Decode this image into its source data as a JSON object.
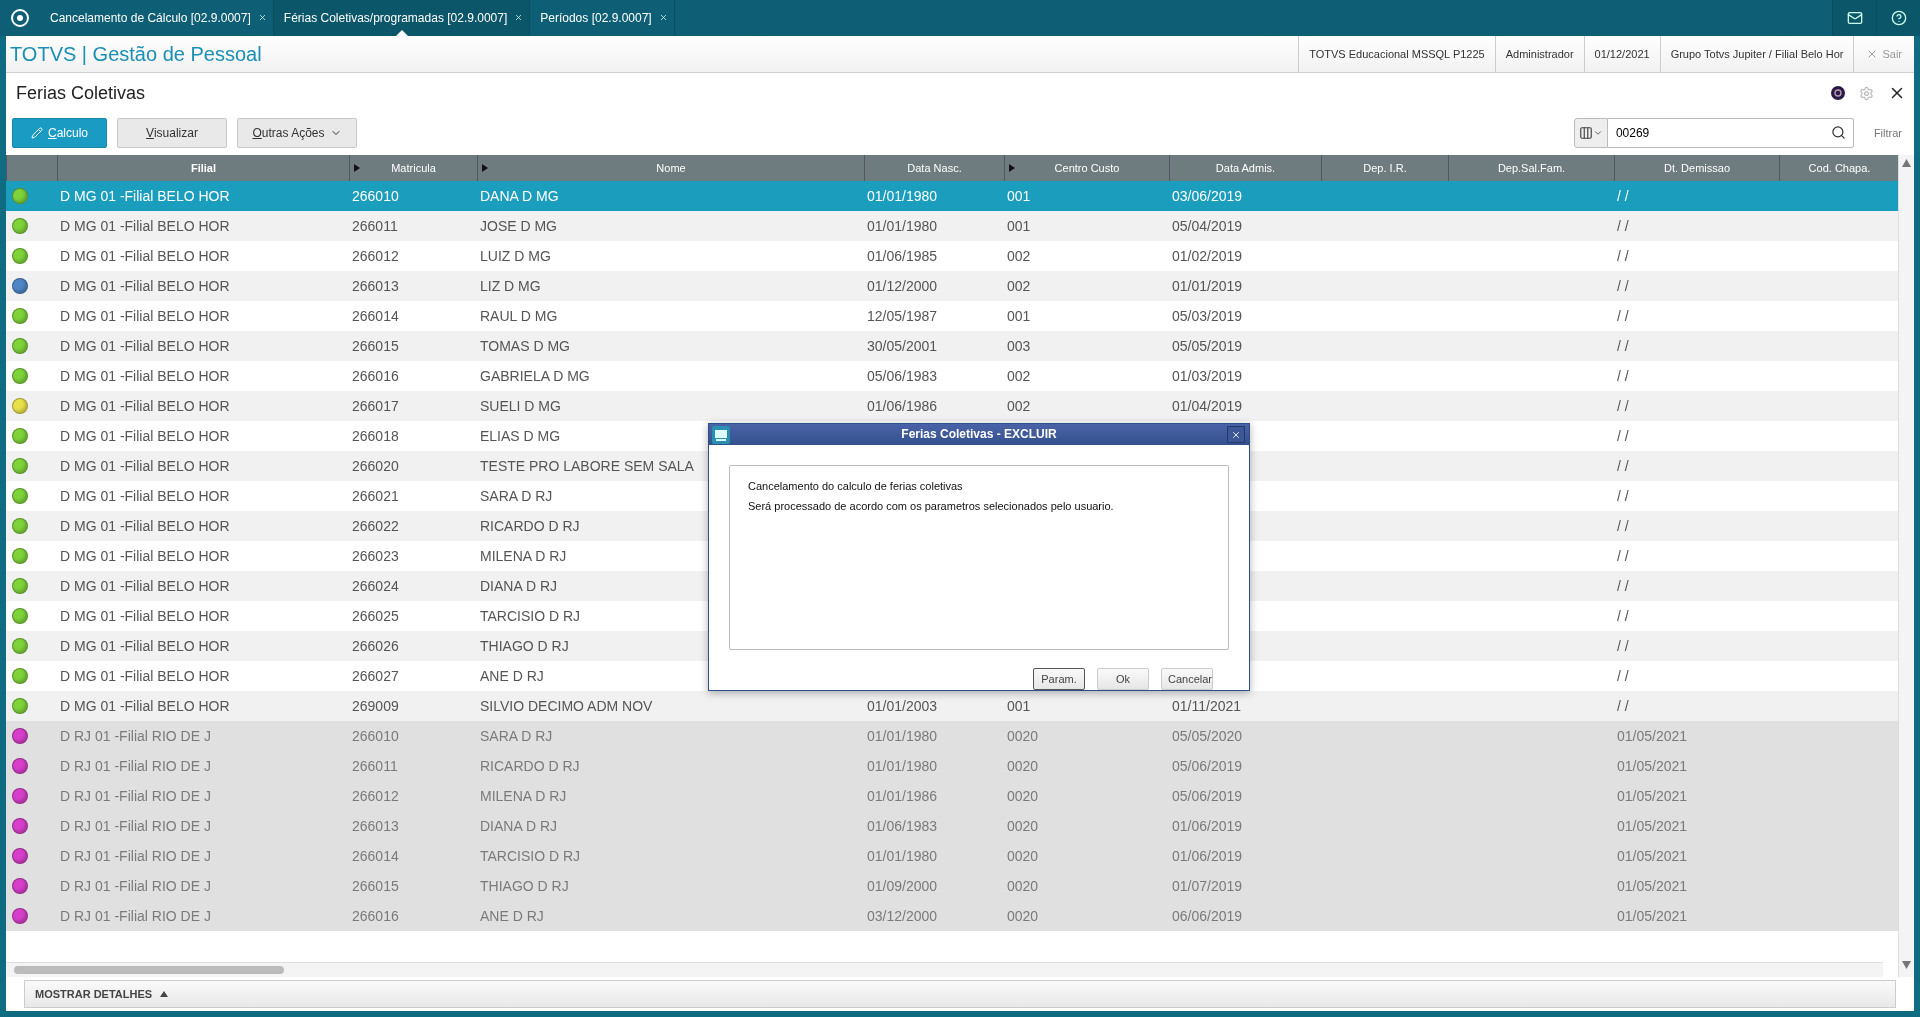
{
  "tabs": [
    {
      "label": "Cancelamento de Cálculo [02.9.0007]",
      "selected": false
    },
    {
      "label": "Férias Coletivas/programadas [02.9.0007]",
      "selected": true
    },
    {
      "label": "Períodos [02.9.0007]",
      "selected": false
    }
  ],
  "header": {
    "brand": "TOTVS | Gestão de Pessoal",
    "info": [
      "TOTVS Educacional MSSQL P1225",
      "Administrador",
      "01/12/2021",
      "Grupo Totvs Jupiter / Filial Belo Hor"
    ],
    "logout": "Sair"
  },
  "page_title": "Ferias Coletivas",
  "toolbar": {
    "buttons": [
      {
        "label": "Calculo",
        "kind": "primary"
      },
      {
        "label": "Visualizar",
        "kind": "default"
      },
      {
        "label": "Outras Ações",
        "kind": "dropdown"
      }
    ],
    "search": {
      "value": "00269"
    },
    "filter_label": "Filtrar"
  },
  "table": {
    "columns": [
      {
        "label": "Filial",
        "marker": false
      },
      {
        "label": "Matricula",
        "marker": true
      },
      {
        "label": "Nome",
        "marker": true
      },
      {
        "label": "Data Nasc.",
        "marker": false
      },
      {
        "label": "Centro Custo",
        "marker": true
      },
      {
        "label": "Data Admis.",
        "marker": false
      },
      {
        "label": "Dep. I.R.",
        "marker": false
      },
      {
        "label": "Dep.Sal.Fam.",
        "marker": false
      },
      {
        "label": "Dt. Demissao",
        "marker": false
      },
      {
        "label": "Cod. Chapa.",
        "marker": false
      }
    ],
    "rows": [
      {
        "color": "#7ed23a",
        "selected": true,
        "dimmed": false,
        "cells": [
          "D MG 01 -Filial BELO HOR",
          "266010",
          "DANA D MG",
          "01/01/1980",
          "001",
          "03/06/2019",
          null,
          null,
          "/  /",
          null
        ]
      },
      {
        "color": "#7ed23a",
        "selected": false,
        "dimmed": false,
        "cells": [
          "D MG 01 -Filial BELO HOR",
          "266011",
          "JOSE D MG",
          "01/01/1980",
          "001",
          "05/04/2019",
          null,
          null,
          "/  /",
          null
        ]
      },
      {
        "color": "#7ed23a",
        "selected": false,
        "dimmed": false,
        "cells": [
          "D MG 01 -Filial BELO HOR",
          "266012",
          "LUIZ D MG",
          "01/06/1985",
          "002",
          "01/02/2019",
          null,
          null,
          "/  /",
          null
        ]
      },
      {
        "color": "#4f86c6",
        "selected": false,
        "dimmed": false,
        "cells": [
          "D MG 01 -Filial BELO HOR",
          "266013",
          "LIZ D MG",
          "01/12/2000",
          "002",
          "01/01/2019",
          null,
          null,
          "/  /",
          null
        ]
      },
      {
        "color": "#7ed23a",
        "selected": false,
        "dimmed": false,
        "cells": [
          "D MG 01 -Filial BELO HOR",
          "266014",
          "RAUL D MG",
          "12/05/1987",
          "001",
          "05/03/2019",
          null,
          null,
          "/  /",
          null
        ]
      },
      {
        "color": "#7ed23a",
        "selected": false,
        "dimmed": false,
        "cells": [
          "D MG 01 -Filial BELO HOR",
          "266015",
          "TOMAS D MG",
          "30/05/2001",
          "003",
          "05/05/2019",
          null,
          null,
          "/  /",
          null
        ]
      },
      {
        "color": "#7ed23a",
        "selected": false,
        "dimmed": false,
        "cells": [
          "D MG 01 -Filial BELO HOR",
          "266016",
          "GABRIELA D MG",
          "05/06/1983",
          "002",
          "01/03/2019",
          null,
          null,
          "/  /",
          null
        ]
      },
      {
        "color": "#e8e04a",
        "selected": false,
        "dimmed": false,
        "cells": [
          "D MG 01 -Filial BELO HOR",
          "266017",
          "SUELI D MG",
          "01/06/1986",
          "002",
          "01/04/2019",
          null,
          null,
          "/  /",
          null
        ]
      },
      {
        "color": "#7ed23a",
        "selected": false,
        "dimmed": false,
        "cells": [
          "D MG 01 -Filial BELO HOR",
          "266018",
          "ELIAS D MG",
          null,
          null,
          null,
          null,
          null,
          "/  /",
          null
        ]
      },
      {
        "color": "#7ed23a",
        "selected": false,
        "dimmed": false,
        "cells": [
          "D MG 01 -Filial BELO HOR",
          "266020",
          "TESTE PRO LABORE SEM SALA",
          null,
          null,
          null,
          null,
          null,
          "/  /",
          null
        ]
      },
      {
        "color": "#7ed23a",
        "selected": false,
        "dimmed": false,
        "cells": [
          "D MG 01 -Filial BELO HOR",
          "266021",
          "SARA D RJ",
          null,
          null,
          null,
          null,
          null,
          "/  /",
          null
        ]
      },
      {
        "color": "#7ed23a",
        "selected": false,
        "dimmed": false,
        "cells": [
          "D MG 01 -Filial BELO HOR",
          "266022",
          "RICARDO D RJ",
          null,
          null,
          null,
          null,
          null,
          "/  /",
          null
        ]
      },
      {
        "color": "#7ed23a",
        "selected": false,
        "dimmed": false,
        "cells": [
          "D MG 01 -Filial BELO HOR",
          "266023",
          "MILENA D RJ",
          null,
          null,
          null,
          null,
          null,
          "/  /",
          null
        ]
      },
      {
        "color": "#7ed23a",
        "selected": false,
        "dimmed": false,
        "cells": [
          "D MG 01 -Filial BELO HOR",
          "266024",
          "DIANA D RJ",
          null,
          null,
          null,
          null,
          null,
          "/  /",
          null
        ]
      },
      {
        "color": "#7ed23a",
        "selected": false,
        "dimmed": false,
        "cells": [
          "D MG 01 -Filial BELO HOR",
          "266025",
          "TARCISIO D RJ",
          null,
          null,
          null,
          null,
          null,
          "/  /",
          null
        ]
      },
      {
        "color": "#7ed23a",
        "selected": false,
        "dimmed": false,
        "cells": [
          "D MG 01 -Filial BELO HOR",
          "266026",
          "THIAGO D RJ",
          null,
          null,
          null,
          null,
          null,
          "/  /",
          null
        ]
      },
      {
        "color": "#7ed23a",
        "selected": false,
        "dimmed": false,
        "cells": [
          "D MG 01 -Filial BELO HOR",
          "266027",
          "ANE D RJ",
          null,
          null,
          null,
          null,
          null,
          "/  /",
          null
        ]
      },
      {
        "color": "#7ed23a",
        "selected": false,
        "dimmed": false,
        "cells": [
          "D MG 01 -Filial BELO HOR",
          "269009",
          "SILVIO DECIMO ADM NOV",
          "01/01/2003",
          "001",
          "01/11/2021",
          null,
          null,
          "/  /",
          null
        ]
      },
      {
        "color": "#d63fc9",
        "selected": false,
        "dimmed": true,
        "cells": [
          "D RJ 01 -Filial RIO DE J",
          "266010",
          "SARA D RJ",
          "01/01/1980",
          "0020",
          "05/05/2020",
          null,
          null,
          "01/05/2021",
          null
        ]
      },
      {
        "color": "#d63fc9",
        "selected": false,
        "dimmed": true,
        "cells": [
          "D RJ 01 -Filial RIO DE J",
          "266011",
          "RICARDO D RJ",
          "01/01/1980",
          "0020",
          "05/06/2019",
          null,
          null,
          "01/05/2021",
          null
        ]
      },
      {
        "color": "#d63fc9",
        "selected": false,
        "dimmed": true,
        "cells": [
          "D RJ 01 -Filial RIO DE J",
          "266012",
          "MILENA D RJ",
          "01/01/1986",
          "0020",
          "05/06/2019",
          null,
          null,
          "01/05/2021",
          null
        ]
      },
      {
        "color": "#d63fc9",
        "selected": false,
        "dimmed": true,
        "cells": [
          "D RJ 01 -Filial RIO DE J",
          "266013",
          "DIANA D RJ",
          "01/06/1983",
          "0020",
          "01/06/2019",
          null,
          null,
          "01/05/2021",
          null
        ]
      },
      {
        "color": "#d63fc9",
        "selected": false,
        "dimmed": true,
        "cells": [
          "D RJ 01 -Filial RIO DE J",
          "266014",
          "TARCISIO D RJ",
          "01/01/1980",
          "0020",
          "01/06/2019",
          null,
          null,
          "01/05/2021",
          null
        ]
      },
      {
        "color": "#d63fc9",
        "selected": false,
        "dimmed": true,
        "cells": [
          "D RJ 01 -Filial RIO DE J",
          "266015",
          "THIAGO D RJ",
          "01/09/2000",
          "0020",
          "01/07/2019",
          null,
          null,
          "01/05/2021",
          null
        ]
      },
      {
        "color": "#d63fc9",
        "selected": false,
        "dimmed": true,
        "cells": [
          "D RJ 01 -Filial RIO DE J",
          "266016",
          "ANE D RJ",
          "03/12/2000",
          "0020",
          "06/06/2019",
          null,
          null,
          "01/05/2021",
          null
        ]
      }
    ]
  },
  "dialog": {
    "title": "Ferias Coletivas - EXCLUIR",
    "lines": [
      "Cancelamento do calculo de ferias coletivas",
      "Será processado de acordo com os parametros selecionados pelo usuario."
    ],
    "buttons": [
      {
        "label": "Param.",
        "focused": true
      },
      {
        "label": "Ok",
        "focused": false
      },
      {
        "label": "Cancelar",
        "focused": false
      }
    ]
  },
  "footer": {
    "details_label": "MOSTRAR DETALHES"
  }
}
